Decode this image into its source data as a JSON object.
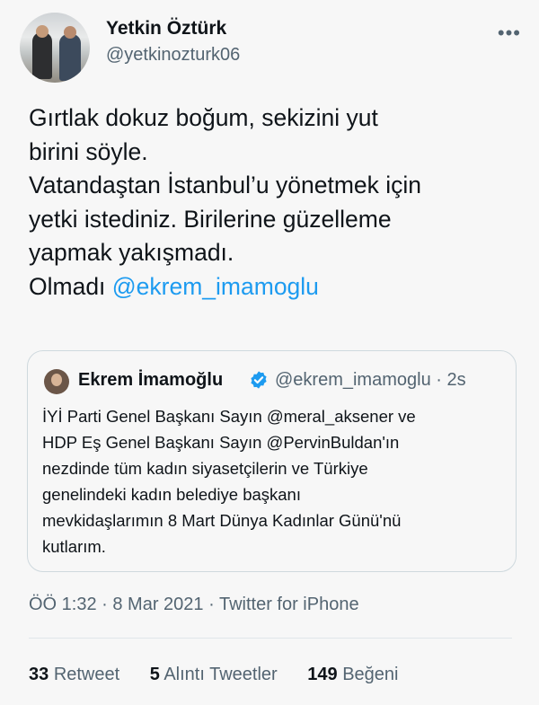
{
  "author": {
    "name": "Yetkin Öztürk",
    "handle": "@yetkinozturk06"
  },
  "more_label": "•••",
  "tweet": {
    "lines": [
      "Gırtlak dokuz boğum, sekizini yut",
      "birini söyle.",
      "Vatandaştan İstanbul’u yönetmek için",
      "yetki istediniz. Birilerine güzelleme",
      "yapmak yakışmadı."
    ],
    "last_line_prefix": "Olmadı ",
    "mention": "@ekrem_imamoglu"
  },
  "quote": {
    "name": "Ekrem İmamoğlu",
    "handle": "@ekrem_imamoglu",
    "separator": "·",
    "time": "2s",
    "lines": [
      "İYİ Parti Genel Başkanı Sayın @meral_aksener ve",
      "HDP Eş Genel Başkanı Sayın @PervinBuldan'ın",
      "nezdinde tüm kadın siyasetçilerin ve Türkiye",
      "genelindeki kadın belediye başkanı",
      "mevkidaşlarımın 8 Mart Dünya Kadınlar Günü'nü",
      "kutlarım."
    ]
  },
  "timestamp": "ÖÖ 1:32 · 8 Mar 2021 · Twitter for iPhone",
  "stats": {
    "retweets_count": "33",
    "retweets_label": "Retweet",
    "quotes_count": "5",
    "quotes_label": "Alıntı Tweetler",
    "likes_count": "149",
    "likes_label": "Beğeni"
  },
  "colors": {
    "accent": "#1d9bf0",
    "secondary_text": "#536471",
    "background": "#f7f7f7"
  }
}
